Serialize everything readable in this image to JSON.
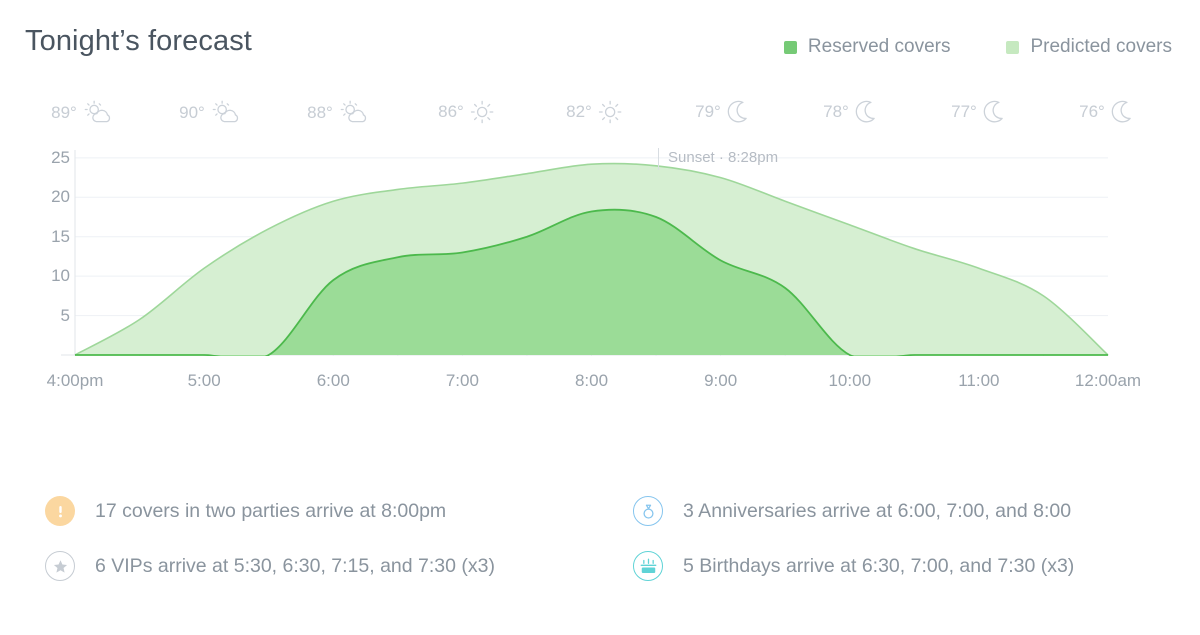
{
  "header": {
    "title": "Tonight’s forecast",
    "legend": [
      {
        "label": "Reserved covers",
        "color": "#76ca76",
        "icon": "square-swatch"
      },
      {
        "label": "Predicted covers",
        "color": "#c6e9c0",
        "icon": "square-swatch"
      }
    ]
  },
  "weather": [
    {
      "temp": "89°",
      "icon": "partly-cloudy-icon"
    },
    {
      "temp": "90°",
      "icon": "partly-cloudy-icon"
    },
    {
      "temp": "88°",
      "icon": "partly-cloudy-icon"
    },
    {
      "temp": "86°",
      "icon": "sun-icon"
    },
    {
      "temp": "82°",
      "icon": "sun-icon"
    },
    {
      "temp": "79°",
      "icon": "moon-icon"
    },
    {
      "temp": "78°",
      "icon": "moon-icon"
    },
    {
      "temp": "77°",
      "icon": "moon-icon"
    },
    {
      "temp": "76°",
      "icon": "moon-icon"
    }
  ],
  "annotation": {
    "sunset": "Sunset · 8:28pm"
  },
  "chart_data": {
    "type": "area",
    "title": "Tonight’s forecast",
    "xlabel": "",
    "ylabel": "",
    "ylim": [
      0,
      26
    ],
    "yticks": [
      5,
      10,
      15,
      20,
      25
    ],
    "grid": true,
    "legend_position": "top-right",
    "x": [
      "4:00pm",
      "4:30",
      "5:00",
      "5:30",
      "6:00",
      "6:30",
      "7:00",
      "7:30",
      "8:00",
      "8:30",
      "9:00",
      "9:30",
      "10:00",
      "10:30",
      "11:00",
      "11:30",
      "12:00am"
    ],
    "xtick_labels": [
      "4:00pm",
      "5:00",
      "6:00",
      "7:00",
      "8:00",
      "9:00",
      "10:00",
      "11:00",
      "12:00am"
    ],
    "series": [
      {
        "name": "Predicted covers",
        "color": "#c6e9c0",
        "values": [
          0,
          4.5,
          11,
          16,
          19.5,
          21,
          21.8,
          23,
          24.2,
          24,
          22.5,
          19.5,
          16.5,
          13.5,
          11,
          7.5,
          0
        ]
      },
      {
        "name": "Reserved covers",
        "color": "#9bdc97",
        "values": [
          0,
          0,
          0,
          0,
          9.5,
          12.4,
          13,
          15,
          18.2,
          17.5,
          12,
          8.5,
          0,
          0,
          0,
          0,
          0
        ]
      }
    ]
  },
  "markers": {
    "row1": [
      {
        "time": "5:30",
        "type": "vip",
        "icon": "star-icon",
        "count": null
      },
      {
        "time": "6:00",
        "type": "anniversary",
        "icon": "ring-icon",
        "count": null
      },
      {
        "time": "6:30",
        "type": "birthday",
        "icon": "cake-icon",
        "count": null
      },
      {
        "time": "7:00",
        "type": "birthday",
        "icon": "cake-icon",
        "count": null
      },
      {
        "time": "7:15",
        "type": "vip",
        "icon": "star-icon",
        "count": null
      },
      {
        "time": "7:30",
        "type": "birthday",
        "icon": "cake-icon",
        "count": "3"
      },
      {
        "time": "8:00",
        "type": "alert",
        "icon": "exclamation-icon",
        "count": null
      }
    ],
    "row2": [
      {
        "time": "6:30",
        "type": "vip",
        "icon": "star-icon",
        "count": null
      },
      {
        "time": "7:00",
        "type": "anniversary",
        "icon": "ring-icon",
        "count": null
      },
      {
        "time": "7:30",
        "type": "vip",
        "icon": "star-icon",
        "count": "3"
      },
      {
        "time": "8:00",
        "type": "anniversary",
        "icon": "ring-icon",
        "count": null
      }
    ]
  },
  "legend_bottom": [
    {
      "type": "alert",
      "icon": "exclamation-icon",
      "text": "17 covers in two parties arrive at 8:00pm"
    },
    {
      "type": "vip",
      "icon": "star-icon",
      "text": "6 VIPs arrive at 5:30, 6:30, 7:15, and 7:30 (x3)"
    },
    {
      "type": "anniversary",
      "icon": "ring-icon",
      "text": "3 Anniversaries arrive at 6:00, 7:00, and 8:00"
    },
    {
      "type": "birthday",
      "icon": "cake-icon",
      "text": "5 Birthdays arrive at 6:30, 7:00, and 7:30 (x3)"
    }
  ],
  "colors": {
    "reserved": "#9bdc97",
    "reserved_stroke": "#4cb94c",
    "predicted": "#d6efd2",
    "predicted_stroke": "#9ed79a",
    "vip": "#c6ccd3",
    "anniversary": "#86c5ee",
    "birthday": "#5fd3d6",
    "alert": "#fbd7a0",
    "badge": "#f5921e"
  }
}
